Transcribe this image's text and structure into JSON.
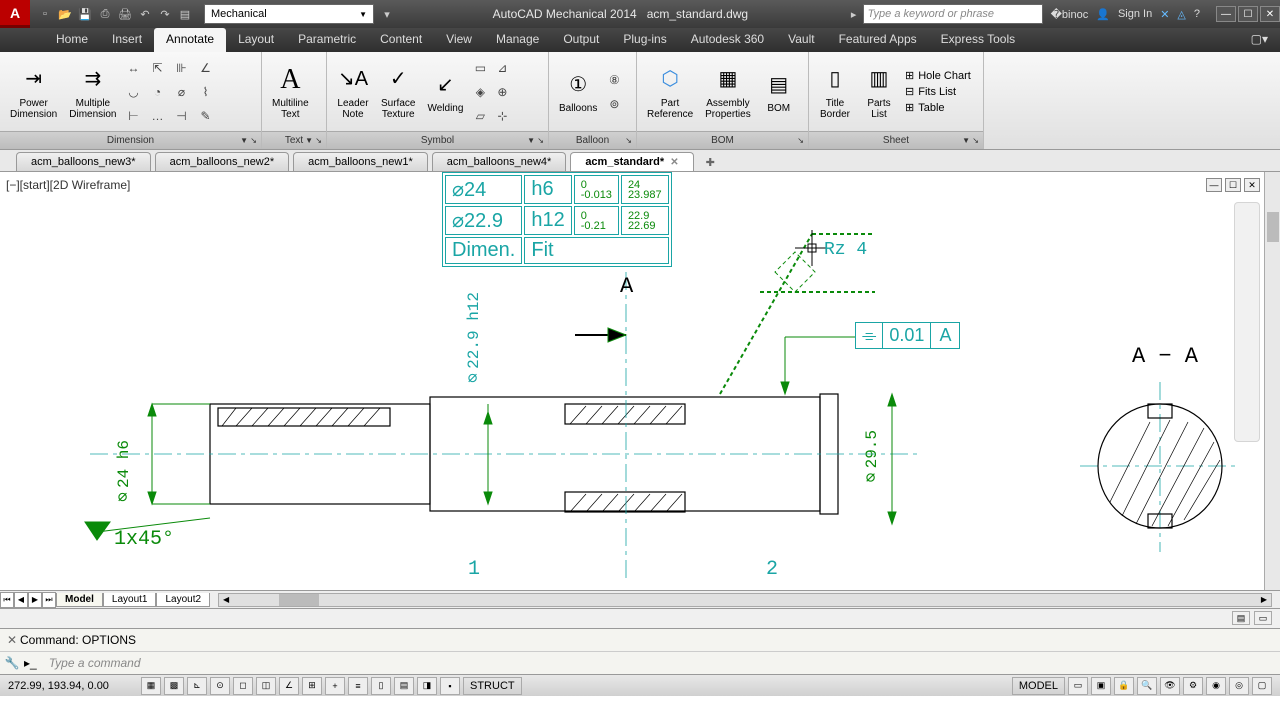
{
  "app": {
    "title": "AutoCAD Mechanical 2014",
    "filename": "acm_standard.dwg",
    "workspace": "Mechanical",
    "search_placeholder": "Type a keyword or phrase",
    "signin": "Sign In"
  },
  "ribbon_tabs": [
    "Home",
    "Insert",
    "Annotate",
    "Layout",
    "Parametric",
    "Content",
    "View",
    "Manage",
    "Output",
    "Plug-ins",
    "Autodesk 360",
    "Vault",
    "Featured Apps",
    "Express Tools"
  ],
  "active_ribbon_tab": "Annotate",
  "panels": {
    "dimension": {
      "title": "Dimension",
      "b1": "Power\nDimension",
      "b2": "Multiple\nDimension"
    },
    "text": {
      "title": "Text",
      "b1": "Multiline\nText"
    },
    "symbol": {
      "title": "Symbol",
      "b1": "Leader\nNote",
      "b2": "Surface\nTexture",
      "b3": "Welding"
    },
    "balloon": {
      "title": "Balloon",
      "b1": "Balloons"
    },
    "bom": {
      "title": "BOM",
      "b1": "Part\nReference",
      "b2": "Assembly\nProperties",
      "b3": "BOM"
    },
    "sheet": {
      "title": "Sheet",
      "b1": "Title\nBorder",
      "b2": "Parts\nList",
      "r1": "Hole Chart",
      "r2": "Fits List",
      "r3": "Table"
    }
  },
  "doc_tabs": [
    "acm_balloons_new3*",
    "acm_balloons_new2*",
    "acm_balloons_new1*",
    "acm_balloons_new4*",
    "acm_standard*"
  ],
  "active_doc": "acm_standard*",
  "viewport_label": "[−][start][2D Wireframe]",
  "fit_table": {
    "r1": {
      "c1": "⌀24",
      "c2": "h6",
      "c3": "0\n-0.013",
      "c4": "24\n23.987"
    },
    "r2": {
      "c1": "⌀22.9",
      "c2": "h12",
      "c3": "0\n-0.21",
      "c4": "22.9\n22.69"
    },
    "r3": {
      "c1": "Dimen.",
      "c2": "Fit"
    }
  },
  "annot": {
    "sectA": "A",
    "sectAA": "A − A",
    "rz": "Rz 4",
    "fcf_val": "0.01",
    "fcf_datum": "A",
    "d1": "⌀24 h6",
    "d2": "⌀22.9 h12",
    "d3": "⌀29.5",
    "chamfer": "1x45°",
    "pos1": "1",
    "pos2": "2"
  },
  "layout_tabs": [
    "Model",
    "Layout1",
    "Layout2"
  ],
  "cmd_history": "Command: OPTIONS",
  "cmd_placeholder": "Type a command",
  "status": {
    "coords": "272.99, 193.94, 0.00",
    "struct": "STRUCT",
    "model": "MODEL"
  }
}
